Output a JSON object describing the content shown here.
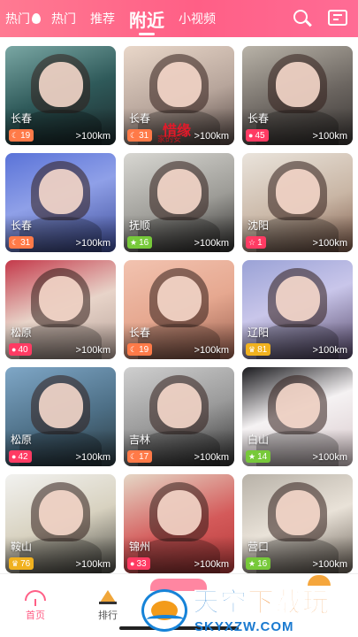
{
  "header": {
    "tabs": [
      {
        "label": "热门",
        "id": "tab-hot-live",
        "fire": true
      },
      {
        "label": "热门",
        "id": "tab-hot"
      },
      {
        "label": "推荐",
        "id": "tab-recommend"
      },
      {
        "label": "附近",
        "id": "tab-nearby",
        "active": true
      },
      {
        "label": "小视频",
        "id": "tab-short-video"
      }
    ],
    "icons": [
      "search-icon",
      "message-icon"
    ],
    "accent": "#ff5f86"
  },
  "cards": [
    {
      "city": "长春",
      "badge": "19",
      "badge_type": "moon",
      "badge_color": "#ff7a48",
      "distance": ">100km",
      "bg": "linear-gradient(160deg,#7aa7a4,#2f5a5a 50%,#1c2a2c)"
    },
    {
      "city": "长春",
      "badge": "31",
      "badge_type": "moon",
      "badge_color": "#ff7a48",
      "distance": ">100km",
      "bg": "linear-gradient(160deg,#e9d7c9,#b7a59b 55%,#534642)",
      "overlay": "惜缘",
      "overlay_sub": "家的安"
    },
    {
      "city": "长春",
      "badge": "45",
      "badge_type": "dot",
      "badge_color": "#ff3b63",
      "distance": ">100km",
      "bg": "linear-gradient(160deg,#b9b3a8,#6b6560 55%,#3a3634)"
    },
    {
      "city": "长春",
      "badge": "31",
      "badge_type": "moon",
      "badge_color": "#ff7a48",
      "distance": ">100km",
      "bg": "linear-gradient(160deg,#5a73d8,#8fa0e8 45%,#3e4d9a)"
    },
    {
      "city": "抚顺",
      "badge": "16",
      "badge_type": "star",
      "badge_color": "#77c93a",
      "distance": ">100km",
      "bg": "linear-gradient(160deg,#d8d7d2,#9d9c97 55%,#2c2b2a)"
    },
    {
      "city": "沈阳",
      "badge": "1",
      "badge_type": "star-outline",
      "badge_color": "#ff3b63",
      "distance": ">100km",
      "bg": "linear-gradient(160deg,#eae4dc,#c9b6a5 55%,#7e5b4a)"
    },
    {
      "city": "松原",
      "badge": "40",
      "badge_type": "dot",
      "badge_color": "#ff3b63",
      "distance": ">100km",
      "bg": "linear-gradient(160deg,#c4394a,#e8d4c9 50%,#b8a39a)"
    },
    {
      "city": "长春",
      "badge": "19",
      "badge_type": "moon",
      "badge_color": "#ff7a48",
      "distance": ">100km",
      "bg": "linear-gradient(160deg,#f2c3b0,#e6a890 50%,#9a5f4e)"
    },
    {
      "city": "辽阳",
      "badge": "81",
      "badge_type": "crown",
      "badge_color": "#f0b11f",
      "distance": ">100km",
      "bg": "linear-gradient(160deg,#9aa2d6,#c9c6ea 45%,#56486a)"
    },
    {
      "city": "松原",
      "badge": "42",
      "badge_type": "dot",
      "badge_color": "#ff3b63",
      "distance": ">100km",
      "bg": "linear-gradient(160deg,#7fa7c7,#4d6f86 55%,#2b3a40)"
    },
    {
      "city": "吉林",
      "badge": "17",
      "badge_type": "moon",
      "badge_color": "#ff7a48",
      "distance": ">100km",
      "bg": "linear-gradient(160deg,#cfcfcf,#9b9b9b 50%,#2f2f2f)"
    },
    {
      "city": "白山",
      "badge": "14",
      "badge_type": "star",
      "badge_color": "#77c93a",
      "distance": ">100km",
      "bg": "linear-gradient(160deg,#1a1a1e,#f5f2f3 45%,#d9c9cc)"
    },
    {
      "city": "鞍山",
      "badge": "76",
      "badge_type": "crown",
      "badge_color": "#f0b11f",
      "distance": ">100km",
      "bg": "linear-gradient(160deg,#f2f2f0,#d8d2c0 50%,#4a4a44)"
    },
    {
      "city": "锦州",
      "badge": "33",
      "badge_type": "dot",
      "badge_color": "#ff3b63",
      "distance": ">100km",
      "bg": "linear-gradient(160deg,#e5d7c6,#d45a5a 55%,#b63a3a)"
    },
    {
      "city": "营口",
      "badge": "16",
      "badge_type": "star",
      "badge_color": "#77c93a",
      "distance": ">100km",
      "bg": "linear-gradient(160deg,#b8b2a8,#e9e2d8 50%,#6b6258)"
    }
  ],
  "bottom_nav": [
    {
      "label": "首页",
      "icon": "umbrella-icon",
      "active": true
    },
    {
      "label": "排行",
      "icon": "ranking-icon"
    }
  ],
  "watermark": {
    "title_part1": "天空",
    "title_part2": "下载玩",
    "url": "SKYXZW.COM"
  }
}
